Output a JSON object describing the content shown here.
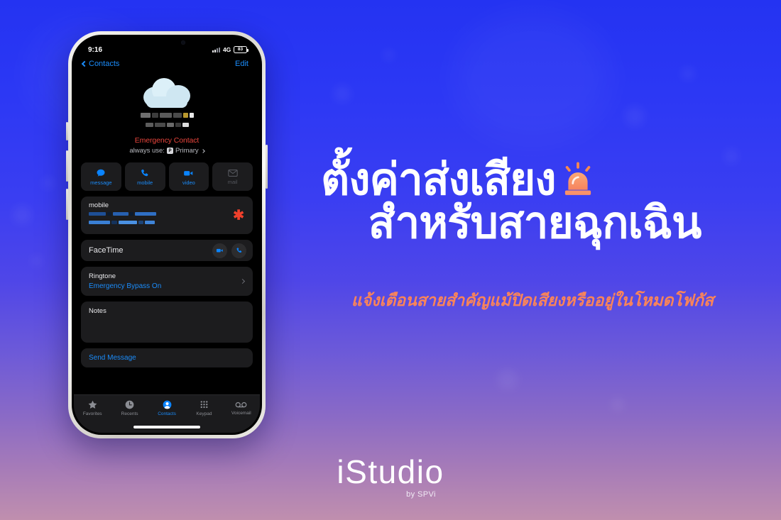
{
  "background": {
    "gradient_top": "#2433f2",
    "gradient_mid": "#6d5ad8",
    "gradient_bottom": "#c08fae"
  },
  "phone": {
    "status_bar": {
      "time": "9:16",
      "network": "4G",
      "battery_level": "83",
      "signal_icon": "signal-bars-icon",
      "battery_icon": "battery-icon"
    },
    "nav": {
      "back_label": "Contacts",
      "back_icon": "chevron-left-icon",
      "edit_label": "Edit"
    },
    "contact": {
      "avatar_icon": "cloud-avatar-icon",
      "name_redacted": true,
      "emergency_label": "Emergency Contact",
      "always_use_prefix": "always use:",
      "always_use_value": "Primary",
      "sim_glyph": "P",
      "disclosure_icon": "chevron-right-icon"
    },
    "actions": [
      {
        "label": "message",
        "icon": "message-bubble-icon",
        "enabled": true
      },
      {
        "label": "mobile",
        "icon": "phone-icon",
        "enabled": true
      },
      {
        "label": "video",
        "icon": "video-camera-icon",
        "enabled": true
      },
      {
        "label": "mail",
        "icon": "envelope-icon",
        "enabled": false
      }
    ],
    "rows": {
      "mobile": {
        "label": "mobile",
        "value_redacted": true,
        "badge_icon": "asterisk-icon",
        "badge_color": "#f0402c"
      },
      "facetime": {
        "label": "FaceTime",
        "video_icon": "video-camera-icon",
        "audio_icon": "phone-icon"
      },
      "ringtone": {
        "label": "Ringtone",
        "value": "Emergency Bypass On",
        "disclosure_icon": "chevron-right-icon"
      },
      "notes": {
        "label": "Notes",
        "value": ""
      },
      "send_message": {
        "label": "Send Message"
      }
    },
    "tabs": [
      {
        "label": "Favorites",
        "icon": "star-icon",
        "active": false
      },
      {
        "label": "Recents",
        "icon": "clock-icon",
        "active": false
      },
      {
        "label": "Contacts",
        "icon": "person-circle-icon",
        "active": true
      },
      {
        "label": "Keypad",
        "icon": "keypad-grid-icon",
        "active": false
      },
      {
        "label": "Voicemail",
        "icon": "voicemail-icon",
        "active": false
      }
    ],
    "accent_blue": "#1b8cfa",
    "emergency_red": "#e8453c"
  },
  "promo": {
    "headline_line1": "ตั้งค่าส่งเสียง",
    "headline_line2": "สำหรับสายฉุกเฉิน",
    "headline_icon": "siren-light-icon",
    "subtitle": "แจ้งเตือนสายสำคัญแม้ปิดเสียงหรืออยู่ในโหมดโฟกัส",
    "subtitle_color": "#f9845a",
    "headline_color": "#ffffff"
  },
  "logo": {
    "main": "iStudio",
    "sub": "by SPVi"
  }
}
